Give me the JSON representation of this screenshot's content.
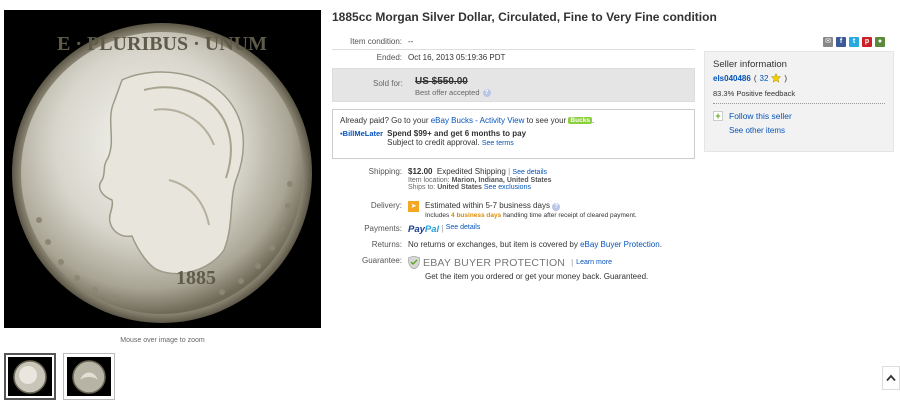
{
  "listing": {
    "title": "1885cc Morgan Silver Dollar, Circulated, Fine to Very Fine condition"
  },
  "image": {
    "zoom_hint": "Mouse over image to zoom",
    "coin_legend_top": "E · PLURIBUS · UNUM",
    "coin_year": "1885"
  },
  "details": {
    "condition_label": "Item condition:",
    "condition_value": "--",
    "ended_label": "Ended:",
    "ended_value": "Oct 16, 2013  05:19:36 PDT",
    "sold_label": "Sold for:",
    "sold_price": "US $550.00",
    "best_offer": "Best offer accepted"
  },
  "paid_box": {
    "prefix": "Already paid? Go to your ",
    "bucks_link": "eBay Bucks - Activity View",
    "middle": " to see your ",
    "bucks_badge": "Bucks",
    "suffix": ".",
    "bml_logo": "BillMeLater",
    "bml_bold": "Spend $99+ and get 6 months to pay",
    "bml_sub": "Subject to credit approval.",
    "bml_terms": "See terms"
  },
  "shipping": {
    "label": "Shipping:",
    "price": "$12.00",
    "method": "Expedited Shipping",
    "see_details": "See details",
    "location_label": "Item location:",
    "location": "Marion, Indiana, United States",
    "ships_label": "Ships to:",
    "ships_to": "United States",
    "exclusions": "See exclusions"
  },
  "delivery": {
    "label": "Delivery:",
    "estimate": "Estimated within 5-7 business days",
    "includes": "Includes ",
    "days": "4 business days",
    "handling": " handling time after receipt of cleared payment."
  },
  "payments": {
    "label": "Payments:",
    "pay": "Pay",
    "pal": "Pal",
    "see_details": "See details"
  },
  "returns": {
    "label": "Returns:",
    "text": "No returns or exchanges, but item is covered by ",
    "link": "eBay Buyer Protection",
    "suffix": "."
  },
  "guarantee": {
    "label": "Guarantee:",
    "logo_text": "EBAY BUYER PROTECTION",
    "learn_more": "Learn more",
    "text": "Get the item you ordered or get your money back. Guaranteed."
  },
  "seller": {
    "heading": "Seller information",
    "name": "els040486",
    "score_open": "(",
    "score": "32",
    "score_close": ")",
    "feedback": "83.3% Positive feedback",
    "follow": "Follow this seller",
    "other_items": "See other items"
  },
  "colors": {
    "link": "#0654ba",
    "orange": "#dd8a00",
    "star": "#f5d000"
  }
}
